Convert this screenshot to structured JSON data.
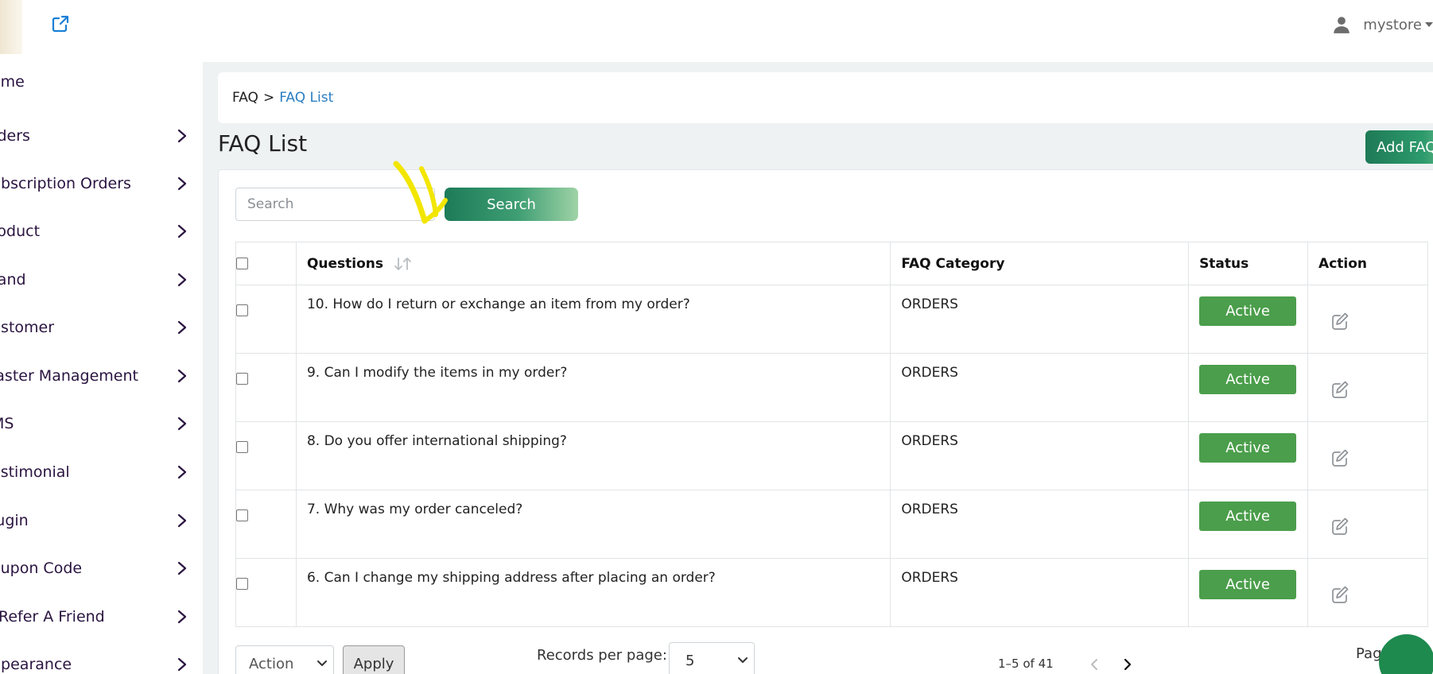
{
  "header": {
    "user_name": "mystore"
  },
  "sidebar": {
    "items": [
      {
        "label": "ome"
      },
      {
        "label": "rders"
      },
      {
        "label": "ubscription Orders"
      },
      {
        "label": "roduct"
      },
      {
        "label": "rand"
      },
      {
        "label": "ustomer"
      },
      {
        "label": "laster Management"
      },
      {
        "label": "MS"
      },
      {
        "label": "estimonial"
      },
      {
        "label": "lugin"
      },
      {
        "label": "oupon Code"
      },
      {
        "label": "Refer A Friend"
      },
      {
        "label": "ppearance"
      }
    ]
  },
  "breadcrumb": {
    "root": "FAQ",
    "separator": ">",
    "current": "FAQ List"
  },
  "page": {
    "title": "FAQ List",
    "add_button": "Add FAQ"
  },
  "search": {
    "placeholder": "Search",
    "button_label": "Search"
  },
  "table": {
    "headers": {
      "questions": "Questions",
      "category": "FAQ Category",
      "status": "Status",
      "action": "Action"
    },
    "rows": [
      {
        "question": "10. How do I return or exchange an item from my order?",
        "category": "ORDERS",
        "status": "Active"
      },
      {
        "question": "9. Can I modify the items in my order?",
        "category": "ORDERS",
        "status": "Active"
      },
      {
        "question": "8. Do you offer international shipping?",
        "category": "ORDERS",
        "status": "Active"
      },
      {
        "question": "7. Why was my order canceled?",
        "category": "ORDERS",
        "status": "Active"
      },
      {
        "question": "6. Can I change my shipping address after placing an order?",
        "category": "ORDERS",
        "status": "Active"
      }
    ]
  },
  "footer": {
    "bulk_action": "Action",
    "apply_label": "Apply",
    "records_label": "Records per page:",
    "records_value": "5",
    "range_text": "1–5 of 41",
    "page_label": "Pag"
  },
  "colors": {
    "brand_green": "#1e7a56",
    "status_green": "#4b9e4b",
    "link_blue": "#2a7ec2",
    "annotation_yellow": "#f2e600"
  }
}
